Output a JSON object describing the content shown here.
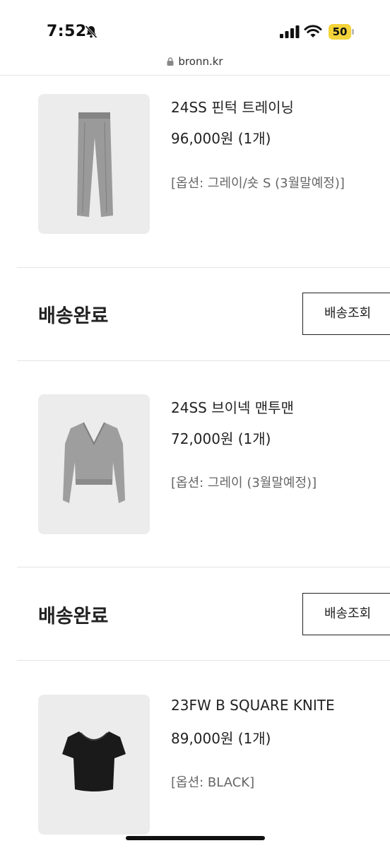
{
  "status_bar": {
    "time": "7:52",
    "battery": "50"
  },
  "browser": {
    "url": "bronn.kr"
  },
  "orders": [
    {
      "name": "24SS 핀턱 트레이닝",
      "price": "96,000원 (1개)",
      "option": "[옵션: 그레이/숏 S (3월말예정)]"
    },
    {
      "name": "24SS 브이넥 맨투맨",
      "price": "72,000원 (1개)",
      "option": "[옵션: 그레이 (3월말예정)]"
    },
    {
      "name": "23FW B SQUARE KNITE",
      "price": "89,000원 (1개)",
      "option": "[옵션: BLACK]"
    }
  ],
  "groups": [
    {
      "status": "배송완료",
      "button": "배송조회"
    },
    {
      "status": "배송완료",
      "button": "배송조회"
    }
  ],
  "colors": {
    "thumb_bg": "#ececec",
    "battery": "#f3d33a",
    "text": "#222222",
    "option_text": "#666666"
  }
}
